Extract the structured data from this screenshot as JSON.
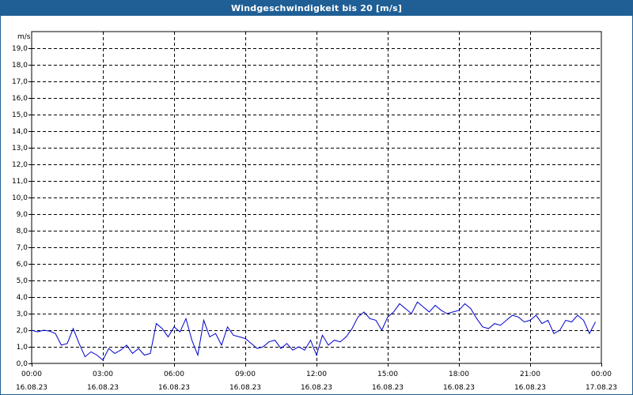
{
  "window": {
    "title": "Windgeschwindigkeit bis 20 [m/s]"
  },
  "chart_data": {
    "type": "line",
    "title": "Windgeschwindigkeit bis 20 [m/s]",
    "ylabel": "m/s",
    "xlabel": "",
    "ylim": [
      0,
      20
    ],
    "xlim_hours": [
      0,
      24
    ],
    "grid": true,
    "line_color": "#0000cc",
    "y_ticks": [
      "0,0",
      "1,0",
      "2,0",
      "3,0",
      "4,0",
      "5,0",
      "6,0",
      "7,0",
      "8,0",
      "9,0",
      "10,0",
      "11,0",
      "12,0",
      "13,0",
      "14,0",
      "15,0",
      "16,0",
      "17,0",
      "18,0",
      "19,0"
    ],
    "x_ticks": [
      {
        "time": "00:00",
        "date": "16.08.23"
      },
      {
        "time": "03:00",
        "date": "16.08.23"
      },
      {
        "time": "06:00",
        "date": "16.08.23"
      },
      {
        "time": "09:00",
        "date": "16.08.23"
      },
      {
        "time": "12:00",
        "date": "16.08.23"
      },
      {
        "time": "15:00",
        "date": "16.08.23"
      },
      {
        "time": "18:00",
        "date": "16.08.23"
      },
      {
        "time": "21:00",
        "date": "16.08.23"
      },
      {
        "time": "00:00",
        "date": "17.08.23"
      }
    ],
    "series": [
      {
        "x": [
          0,
          0.25,
          0.5,
          0.75,
          1,
          1.25,
          1.5,
          1.75,
          2,
          2.25,
          2.5,
          2.75,
          3,
          3.25,
          3.5,
          3.75,
          4,
          4.25,
          4.5,
          4.75,
          5,
          5.25,
          5.5,
          5.75,
          6,
          6.25,
          6.5,
          6.75,
          7,
          7.25,
          7.5,
          7.75,
          8,
          8.25,
          8.5,
          8.75,
          9,
          9.25,
          9.5,
          9.75,
          10,
          10.25,
          10.5,
          10.75,
          11,
          11.25,
          11.5,
          11.75,
          12,
          12.25,
          12.5,
          12.75,
          13,
          13.25,
          13.5,
          13.75,
          14,
          14.25,
          14.5,
          14.75,
          15,
          15.25,
          15.5,
          15.75,
          16,
          16.25,
          16.5,
          16.75,
          17,
          17.25,
          17.5,
          17.75,
          18,
          18.25,
          18.5,
          18.75,
          19,
          19.25,
          19.5,
          19.75,
          20,
          20.25,
          20.5,
          20.75,
          21,
          21.25,
          21.5,
          21.75,
          22,
          22.25,
          22.5,
          22.75,
          23,
          23.25,
          23.5,
          23.75
        ],
        "y": [
          2.0,
          1.9,
          2.0,
          1.95,
          1.8,
          1.1,
          1.2,
          2.1,
          1.2,
          0.4,
          0.7,
          0.5,
          0.2,
          0.9,
          0.6,
          0.8,
          1.1,
          0.6,
          0.9,
          0.5,
          0.6,
          2.4,
          2.1,
          1.6,
          2.2,
          1.9,
          2.7,
          1.4,
          0.5,
          2.6,
          1.6,
          1.8,
          1.1,
          2.2,
          1.7,
          1.6,
          1.5,
          1.2,
          0.9,
          1.0,
          1.3,
          1.4,
          0.9,
          1.2,
          0.8,
          1.0,
          0.8,
          1.4,
          0.5,
          1.7,
          1.1,
          1.4,
          1.3,
          1.6,
          2.1,
          2.8,
          3.1,
          2.7,
          2.6,
          2.0,
          2.8,
          3.1,
          3.6,
          3.3,
          3.0,
          3.7,
          3.4,
          3.1,
          3.5,
          3.2,
          3.0,
          3.1,
          3.2,
          3.6,
          3.3,
          2.7,
          2.2,
          2.1,
          2.4,
          2.3,
          2.6,
          2.9,
          2.8,
          2.5,
          2.6,
          2.9,
          2.4,
          2.6,
          1.8,
          2.0,
          2.6,
          2.5,
          2.9,
          2.6,
          1.8,
          2.5
        ]
      }
    ]
  }
}
